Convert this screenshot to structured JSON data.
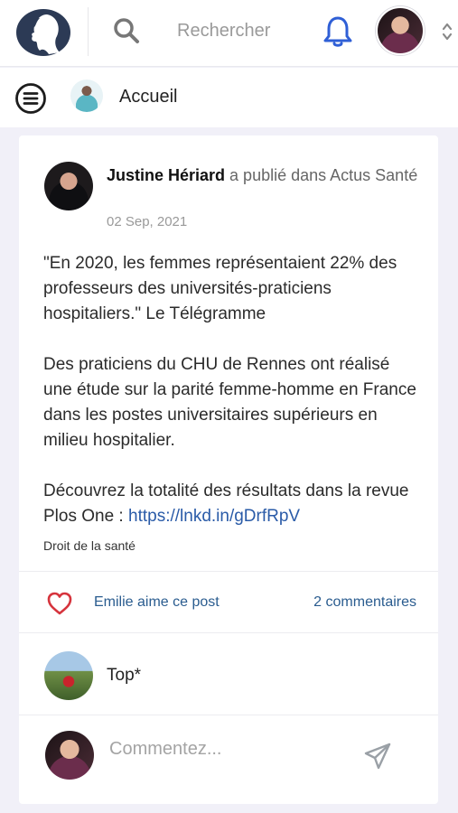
{
  "header": {
    "search_placeholder": "Rechercher"
  },
  "subheader": {
    "title": "Accueil"
  },
  "post": {
    "author": "Justine Hériard",
    "action": " a publié dans Actus Santé",
    "date": "02 Sep, 2021",
    "paragraphs": [
      "\"En 2020, les femmes représentaient 22% des professeurs des universités-praticiens hospitaliers.\" Le Télégramme",
      "Des praticiens du CHU de Rennes ont réalisé une étude sur la parité femme-homme en France dans les postes universitaires supérieurs en milieu hospitalier.",
      "Découvrez la totalité des résultats dans la revue Plos One : "
    ],
    "link": "https://lnkd.in/gDrfRpV",
    "tag": "Droit de la santé",
    "likes_text": "Emilie aime ce post",
    "comments_count": "2 commentaires"
  },
  "comments": [
    {
      "text": "Top*"
    }
  ],
  "compose": {
    "placeholder": "Commentez..."
  },
  "colors": {
    "accent": "#2a5c8f",
    "bell": "#2f5fd6",
    "heart": "#d6343d"
  }
}
